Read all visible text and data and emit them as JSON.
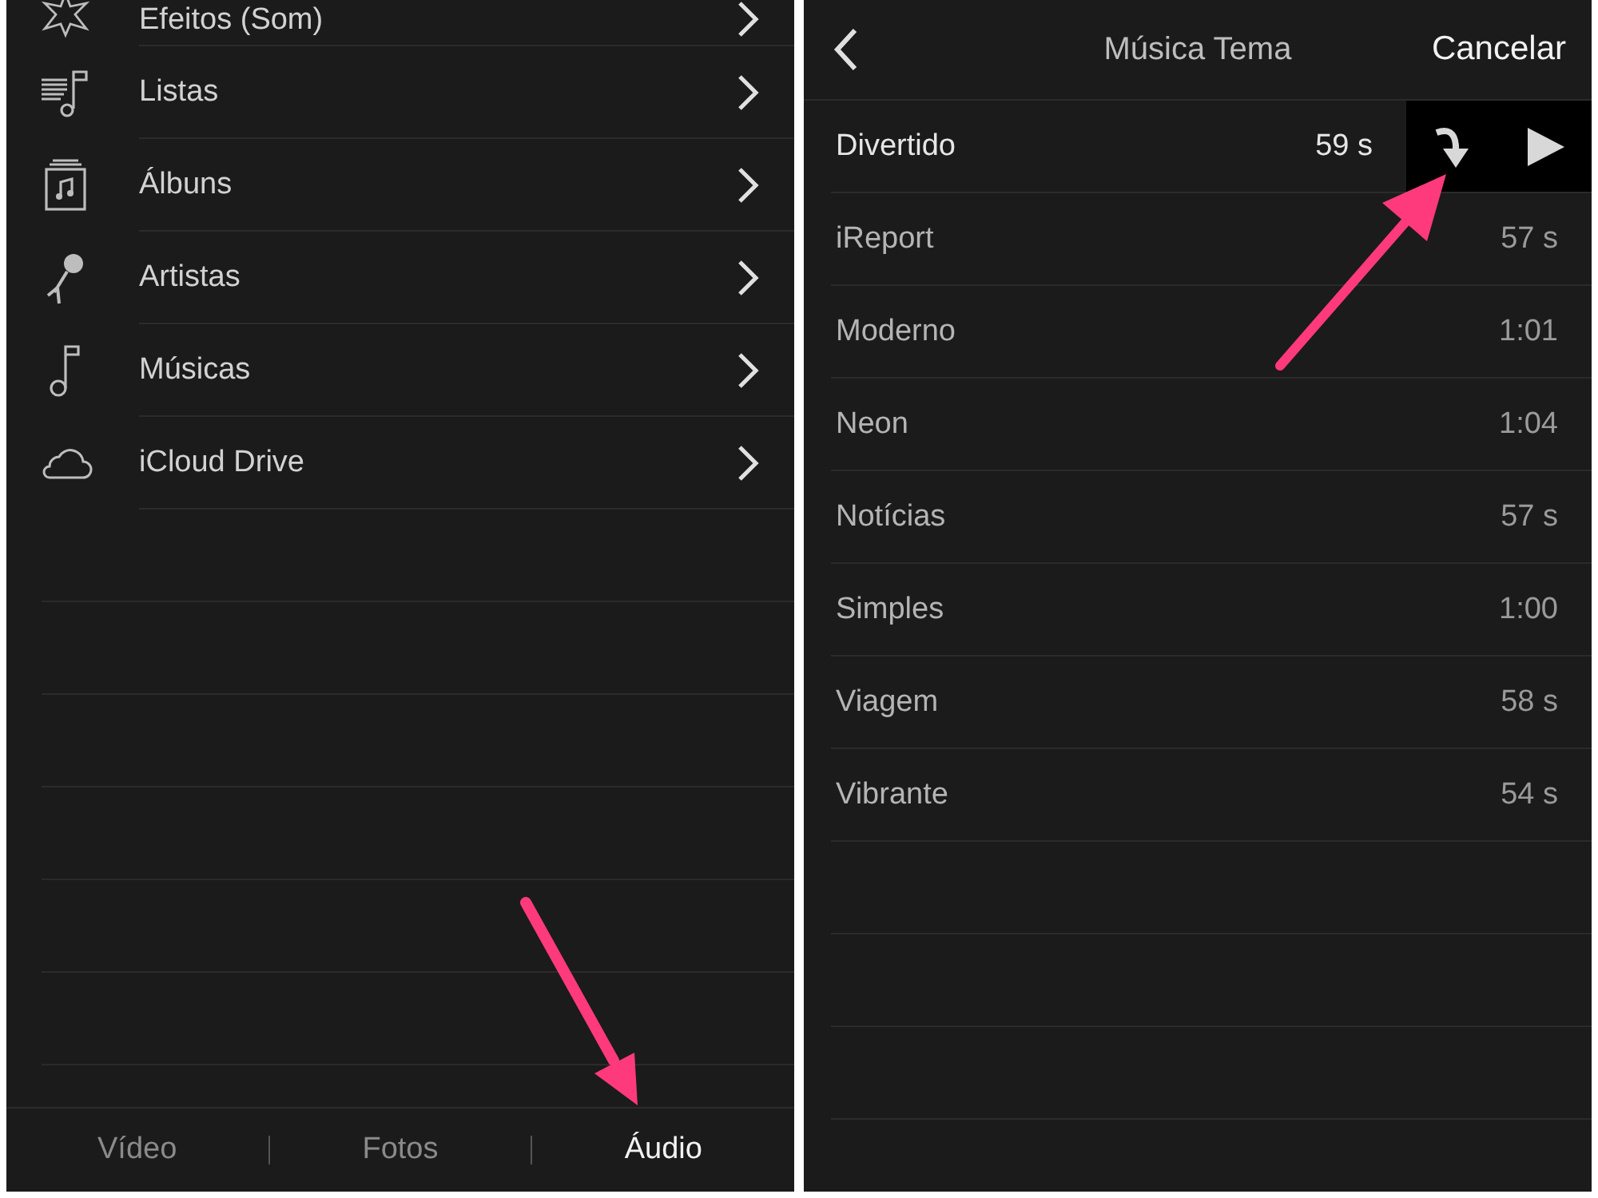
{
  "library": {
    "items": [
      {
        "kind": "star",
        "label": "Efeitos (Som)"
      },
      {
        "kind": "playlist",
        "label": "Listas"
      },
      {
        "kind": "album",
        "label": "Álbuns"
      },
      {
        "kind": "microphone",
        "label": "Artistas"
      },
      {
        "kind": "note",
        "label": "Músicas"
      },
      {
        "kind": "cloud",
        "label": "iCloud Drive"
      }
    ]
  },
  "tabs": [
    {
      "label": "Vídeo",
      "selected": false
    },
    {
      "label": "Fotos",
      "selected": false
    },
    {
      "label": "Áudio",
      "selected": true
    }
  ],
  "theme_music": {
    "title": "Música Tema",
    "cancel": "Cancelar",
    "rows": [
      {
        "name": "Divertido",
        "duration": "59 s",
        "selected": true
      },
      {
        "name": "iReport",
        "duration": "57 s",
        "selected": false
      },
      {
        "name": "Moderno",
        "duration": "1:01",
        "selected": false
      },
      {
        "name": "Neon",
        "duration": "1:04",
        "selected": false
      },
      {
        "name": "Notícias",
        "duration": "57 s",
        "selected": false
      },
      {
        "name": "Simples",
        "duration": "1:00",
        "selected": false
      },
      {
        "name": "Viagem",
        "duration": "58 s",
        "selected": false
      },
      {
        "name": "Vibrante",
        "duration": "54 s",
        "selected": false
      }
    ]
  }
}
